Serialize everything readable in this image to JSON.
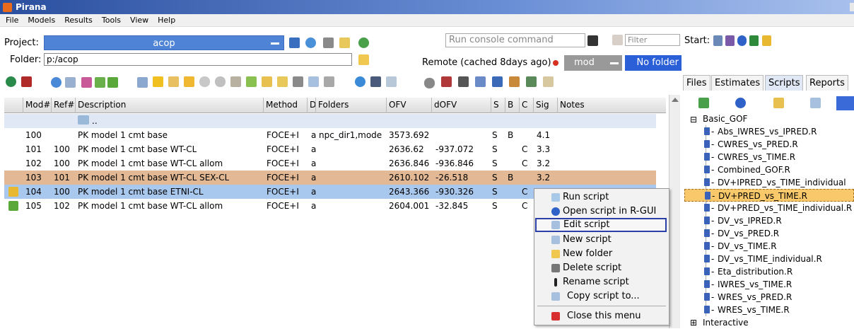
{
  "window": {
    "title": "Pirana"
  },
  "menu": [
    "File",
    "Models",
    "Results",
    "Tools",
    "View",
    "Help"
  ],
  "project": {
    "label": "Project:",
    "value": "acop"
  },
  "folder": {
    "label": "Folder:",
    "value": "p:/acop"
  },
  "console": {
    "placeholder": "Run console command"
  },
  "filter": {
    "placeholder": "Filter"
  },
  "start_label": "Start:",
  "remote": {
    "label": "Remote (cached 8days ago)",
    "mod_value": "mod",
    "no_folder": "No folder"
  },
  "table": {
    "columns": [
      "Mod#",
      "Ref#",
      "Description",
      "Method",
      "D",
      "Folders",
      "OFV",
      "dOFV",
      "S",
      "B",
      "C",
      "Sig",
      "Notes"
    ],
    "parent_row": "..",
    "rows": [
      {
        "mod": "100",
        "ref": "",
        "desc": "PK model 1 cmt base",
        "method": "FOCE+I",
        "d": "a",
        "folders": "npc_dir1,mode",
        "ofv": "3573.692",
        "dofv": "",
        "s": "S",
        "b": "B",
        "c": "",
        "sig": "4.1",
        "icon": "",
        "style": "normal"
      },
      {
        "mod": "101",
        "ref": "100",
        "desc": "PK model 1 cmt base WT-CL",
        "method": "FOCE+I",
        "d": "a",
        "folders": "",
        "ofv": "2636.62",
        "dofv": "-937.072",
        "s": "S",
        "b": "",
        "c": "C",
        "sig": "3.3",
        "icon": "",
        "style": "normal"
      },
      {
        "mod": "102",
        "ref": "100",
        "desc": "PK model 1 cmt base WT-CL allom",
        "method": "FOCE+I",
        "d": "a",
        "folders": "",
        "ofv": "2636.846",
        "dofv": "-936.846",
        "s": "S",
        "b": "",
        "c": "C",
        "sig": "3.2",
        "icon": "",
        "style": "normal"
      },
      {
        "mod": "103",
        "ref": "101",
        "desc": "PK model 1 cmt base WT-CL SEX-CL",
        "method": "FOCE+I",
        "d": "a",
        "folders": "",
        "ofv": "2610.102",
        "dofv": "-26.518",
        "s": "S",
        "b": "B",
        "c": "",
        "sig": "3.2",
        "icon": "",
        "style": "tan"
      },
      {
        "mod": "104",
        "ref": "100",
        "desc": "PK model 1 cmt base ETNI-CL",
        "method": "FOCE+I",
        "d": "a",
        "folders": "",
        "ofv": "2643.366",
        "dofv": "-930.326",
        "s": "S",
        "b": "",
        "c": "C",
        "sig": "",
        "icon": "key-icon",
        "style": "selected"
      },
      {
        "mod": "105",
        "ref": "102",
        "desc": "PK model 1 cmt base WT-CL allom",
        "method": "FOCE+I",
        "d": "a",
        "folders": "",
        "ofv": "2604.001",
        "dofv": "-32.845",
        "s": "S",
        "b": "",
        "c": "C",
        "sig": "",
        "icon": "flag-icon",
        "style": "normal"
      }
    ]
  },
  "tabs": [
    "Files",
    "Estimates",
    "Scripts",
    "Reports"
  ],
  "active_tab": "Scripts",
  "tree": {
    "group": "Basic_GOF",
    "items": [
      "Abs_IWRES_vs_IPRED.R",
      "CWRES_vs_PRED.R",
      "CWRES_vs_TIME.R",
      "Combined_GOF.R",
      "DV+IPRED_vs_TIME_individual",
      "DV+PRED_vs_TIME.R",
      "DV+PRED_vs_TIME_individual.R",
      "DV_vs_IPRED.R",
      "DV_vs_PRED.R",
      "DV_vs_TIME.R",
      "DV_vs_TIME_individual.R",
      "Eta_distribution.R",
      "IWRES_vs_TIME.R",
      "WRES_vs_PRED.R",
      "WRES_vs_TIME.R"
    ],
    "selected_index": 5,
    "group2": "Interactive"
  },
  "context_menu": {
    "items": [
      "Run script",
      "Open script in R-GUI",
      "Edit script",
      "New script",
      "New folder",
      "Delete script",
      "Rename script",
      "Copy script to...",
      "Close this menu"
    ],
    "highlighted": "Edit script"
  },
  "colors": {
    "selected_row": "#a9c8ee",
    "tan_row": "#e2b994",
    "project_bar": "#4f83d6",
    "tree_selected": "#f9c86a"
  }
}
